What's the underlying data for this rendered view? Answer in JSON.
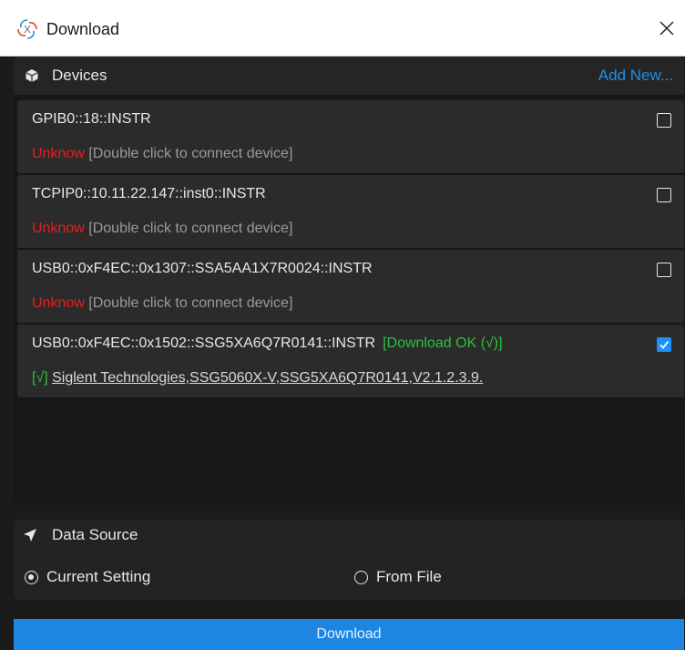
{
  "window": {
    "title": "Download",
    "close_icon": "close-icon",
    "app_icon": "app-swirl-icon"
  },
  "devices": {
    "title": "Devices",
    "header_icon": "cube-icon",
    "add_new_label": "Add New...",
    "items": [
      {
        "address": "GPIB0::18::INSTR",
        "state": "Unknow",
        "hint": "[Double click to connect device]",
        "checked": false,
        "download_status": "",
        "identity": ""
      },
      {
        "address": "TCPIP0::10.11.22.147::inst0::INSTR",
        "state": "Unknow",
        "hint": "[Double click to connect device]",
        "checked": false,
        "download_status": "",
        "identity": ""
      },
      {
        "address": "USB0::0xF4EC::0x1307::SSA5AA1X7R0024::INSTR",
        "state": "Unknow",
        "hint": "[Double click to connect device]",
        "checked": false,
        "download_status": "",
        "identity": ""
      },
      {
        "address": "USB0::0xF4EC::0x1502::SSG5XA6Q7R0141::INSTR",
        "state": "[√]",
        "hint": "",
        "checked": true,
        "download_status": "[Download OK (√)]",
        "identity": "Siglent Technologies,SSG5060X-V,SSG5XA6Q7R0141,V2.1.2.3.9."
      }
    ]
  },
  "data_source": {
    "title": "Data Source",
    "header_icon": "send-arrow-icon",
    "options": [
      {
        "label": "Current Setting",
        "selected": true
      },
      {
        "label": "From File",
        "selected": false
      }
    ]
  },
  "download_button": {
    "label": "Download"
  },
  "colors": {
    "accent": "#1e90e8",
    "ok": "#2fbf3f",
    "error": "#e02020",
    "button": "#1c86e0"
  }
}
